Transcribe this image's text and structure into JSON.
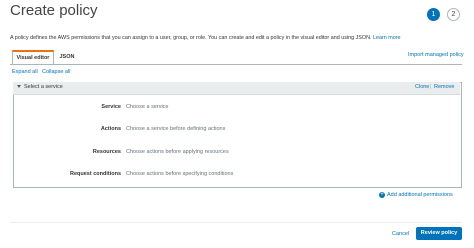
{
  "header": {
    "title": "Create policy",
    "steps": [
      "1",
      "2"
    ]
  },
  "intro": {
    "text": "A policy defines the AWS permissions that you can assign to a user, group, or role. You can create and edit a policy in the visual editor and using JSON.",
    "link": "Learn more"
  },
  "tabs": [
    {
      "label": "Visual editor"
    },
    {
      "label": "JSON"
    }
  ],
  "import_label": "Import managed policy",
  "toolbar": {
    "expand_all": "Expand all",
    "collapse_all": "Collapse all"
  },
  "panel": {
    "select_label": "Select a service",
    "clone": "Clone",
    "separator": "|",
    "remove": "Remove",
    "rows": [
      {
        "label": "Service",
        "value": "Choose a service"
      },
      {
        "label": "Actions",
        "value": "Choose a service before defining actions"
      },
      {
        "label": "Resources",
        "value": "Choose actions before applying resources"
      },
      {
        "label": "Request conditions",
        "value": "Choose actions before specifying conditions"
      }
    ]
  },
  "add_permissions": "Add additional permissions",
  "footer": {
    "cancel": "Cancel",
    "review": "Review policy"
  },
  "colors": {
    "accent": "#0073bb",
    "tab_highlight": "#ec7211"
  }
}
